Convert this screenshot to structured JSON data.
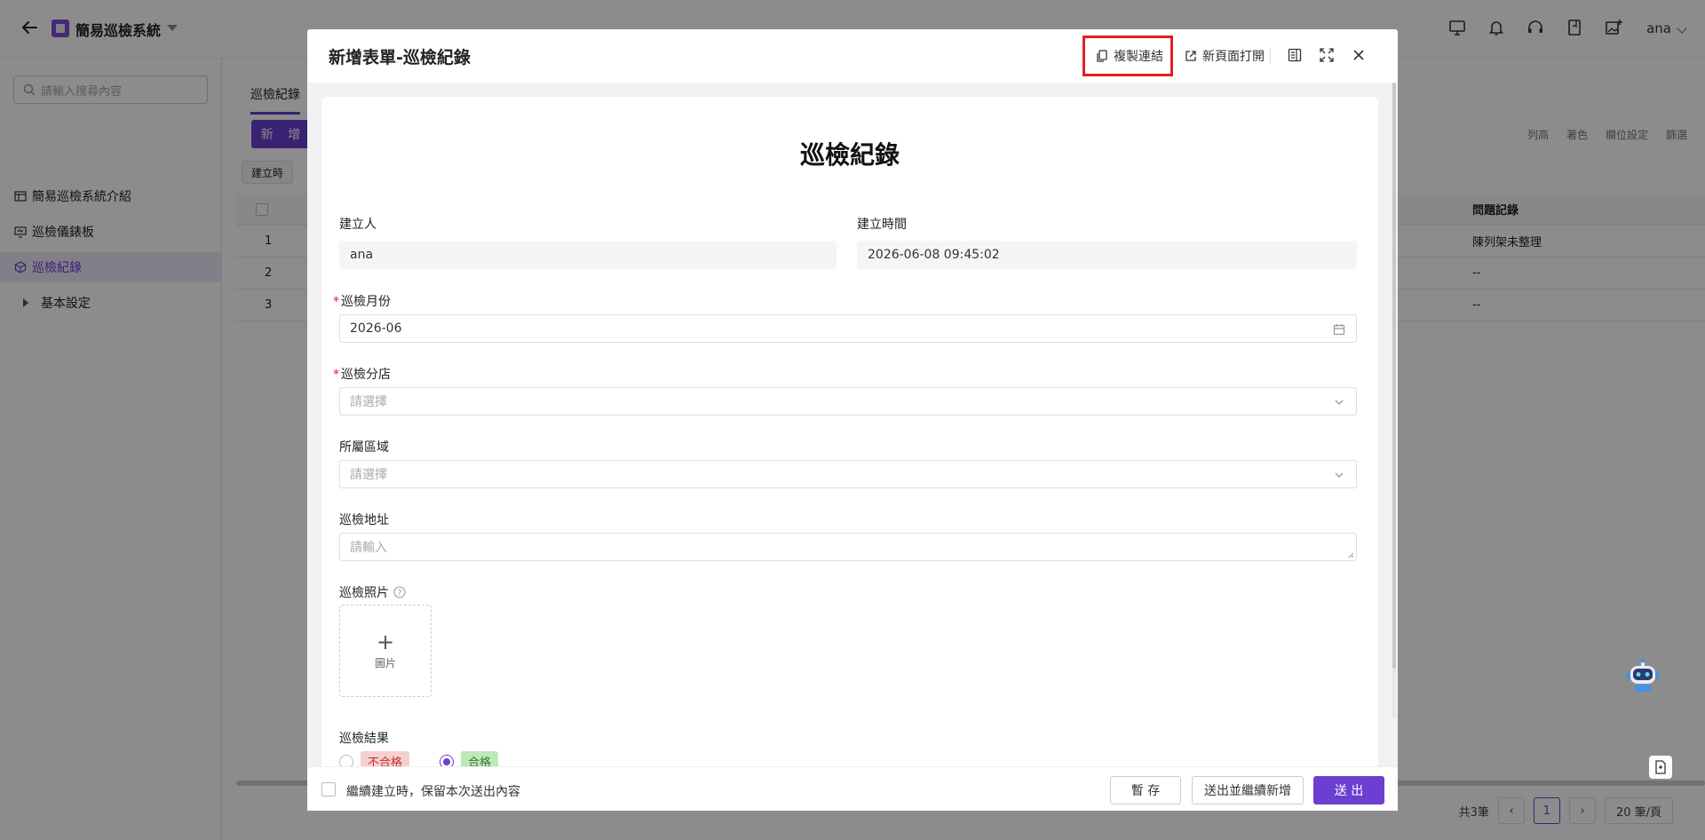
{
  "app": {
    "title": "簡易巡檢系統",
    "user": "ana"
  },
  "sidebar": {
    "search_placeholder": "請輸入搜尋內容",
    "items": [
      {
        "label": "簡易巡檢系統介紹"
      },
      {
        "label": "巡檢儀錶板"
      },
      {
        "label": "巡檢紀錄"
      },
      {
        "label": "基本設定"
      }
    ]
  },
  "main": {
    "tab": "巡檢紀錄",
    "add_button": "新 增",
    "toolbar": [
      "列高",
      "著色",
      "欄位設定",
      "篩選"
    ],
    "filter_chip": "建立時",
    "table": {
      "issue_header": "問題記錄",
      "rows": [
        {
          "index": "1",
          "issue": "陳列架未整理"
        },
        {
          "index": "2",
          "issue": "--"
        },
        {
          "index": "3",
          "issue": "--"
        }
      ]
    },
    "pager": {
      "total": "共3筆",
      "page": "1",
      "size": "20 筆/頁"
    }
  },
  "modal": {
    "title": "新增表單-巡檢紀錄",
    "copy_link": "複製連結",
    "open_new_page": "新頁面打開",
    "form_title": "巡檢紀錄",
    "fields": {
      "creator_label": "建立人",
      "creator_value": "ana",
      "created_time_label": "建立時間",
      "created_time_value": "2026-06-08 09:45:02",
      "month_label": "巡檢月份",
      "month_value": "2026-06",
      "branch_label": "巡檢分店",
      "branch_placeholder": "請選擇",
      "region_label": "所屬區域",
      "region_placeholder": "請選擇",
      "address_label": "巡檢地址",
      "address_placeholder": "請輸入",
      "photo_label": "巡檢照片",
      "photo_upload": "圖片",
      "result_label": "巡檢結果",
      "result_fail": "不合格",
      "result_pass": "合格"
    },
    "footer": {
      "keep_content": "繼續建立時，保留本次送出內容",
      "save_draft": "暫 存",
      "submit_continue": "送出並繼續新增",
      "submit": "送 出"
    }
  }
}
